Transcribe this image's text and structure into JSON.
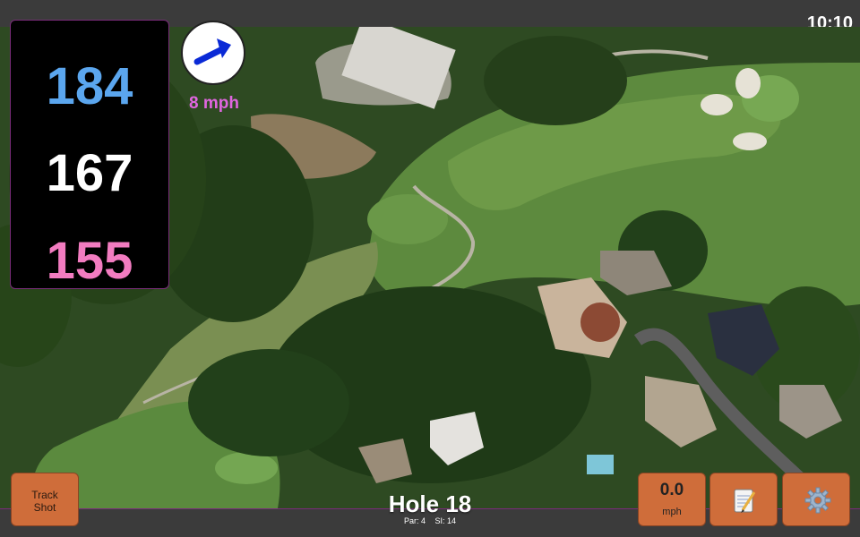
{
  "status_bar": {
    "clock": "10:10"
  },
  "distances": {
    "back": "184",
    "middle": "167",
    "front": "155"
  },
  "wind": {
    "speed": "8 mph",
    "icon": "arrow-icon"
  },
  "hole": {
    "label": "Hole 18",
    "par": "Par: 4",
    "stroke_index": "SI: 14"
  },
  "buttons": {
    "track_shot": {
      "line1": "Track",
      "line2": "Shot"
    },
    "speed": {
      "value": "0.0",
      "unit": "mph"
    },
    "notes": {
      "icon": "notepad-icon"
    },
    "settings": {
      "icon": "gear-icon"
    }
  },
  "colors": {
    "back_distance": "#5ba6ee",
    "middle_distance": "#ffffff",
    "front_distance": "#f27cc0",
    "wind_speed": "#e066e0",
    "button": "#cf6d3a"
  }
}
